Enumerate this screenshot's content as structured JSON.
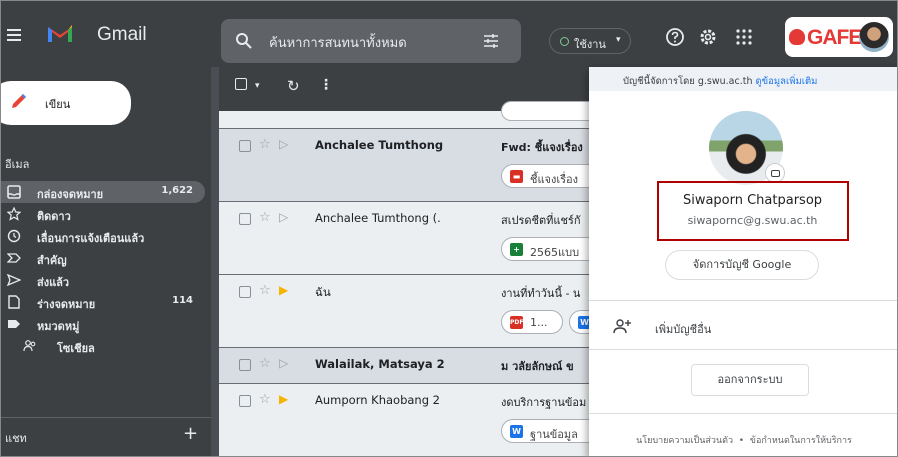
{
  "topbar": {
    "app_name": "Gmail",
    "search_placeholder": "ค้นหาการสนทนาทั้งหมด",
    "status_label": "ใช้งาน",
    "org_logo_text": "GAFE"
  },
  "sidebar": {
    "compose_label": "เขียน",
    "mail_section": "อีเมล",
    "items": [
      {
        "label": "กล่องจดหมาย",
        "count": "1,622",
        "icon": "inbox-icon"
      },
      {
        "label": "ติดดาว",
        "count": "",
        "icon": "star-icon"
      },
      {
        "label": "เลื่อนการแจ้งเตือนแล้ว",
        "count": "",
        "icon": "clock-icon"
      },
      {
        "label": "สำคัญ",
        "count": "",
        "icon": "important-icon"
      },
      {
        "label": "ส่งแล้ว",
        "count": "",
        "icon": "send-icon"
      },
      {
        "label": "ร่างจดหมาย",
        "count": "114",
        "icon": "draft-icon"
      },
      {
        "label": "หมวดหมู่",
        "count": "",
        "icon": "label-icon"
      },
      {
        "label": "โซเชียล",
        "count": "",
        "icon": "people-icon"
      }
    ],
    "chat_section": "แชท"
  },
  "emails": [
    {
      "sender": "Anchalee Tumthong",
      "subject": "Fwd: ชี้แจงเรื่อง",
      "chip": "ชี้แจงเรื่อง",
      "chip_icon": "slides-icon",
      "unread": true,
      "important": false
    },
    {
      "sender": "Anchalee Tumthong (.",
      "subject": "สเปรดชีตที่แชร์กั",
      "chip": "2565แบบ",
      "chip_icon": "sheets-icon",
      "unread": false,
      "important": false
    },
    {
      "sender": "ฉัน",
      "subject": "งานที่ทำวันนี้ - น",
      "chip": "1...",
      "chip_icon": "pdf-icon",
      "unread": false,
      "important": true
    },
    {
      "sender": "Walailak, Matsaya 2",
      "subject": "ม วลัยลักษณ์ ข",
      "chip": "",
      "chip_icon": "",
      "unread": true,
      "important": false
    },
    {
      "sender": "Aumporn Khaobang 2",
      "subject": "งดบริการฐานข้อม",
      "chip": "ฐานข้อมูล",
      "chip_icon": "word-icon",
      "unread": false,
      "important": true
    }
  ],
  "account_popup": {
    "managed_text": "บัญชีนี้จัดการโดย g.swu.ac.th",
    "managed_link": "ดูข้อมูลเพิ่มเติม",
    "name": "Siwaporn Chatparsop",
    "email": "siwapornc@g.swu.ac.th",
    "manage_button": "จัดการบัญชี Google",
    "add_account": "เพิ่มบัญชีอื่น",
    "sign_out": "ออกจากระบบ",
    "privacy": "นโยบายความเป็นส่วนตัว",
    "separator": "•",
    "terms": "ข้อกำหนดในการให้บริการ"
  },
  "colors": {
    "topbar_bg": "#3c4043",
    "accent_red": "#b00000",
    "link_blue": "#1a73e8",
    "important_yellow": "#f4b400"
  }
}
